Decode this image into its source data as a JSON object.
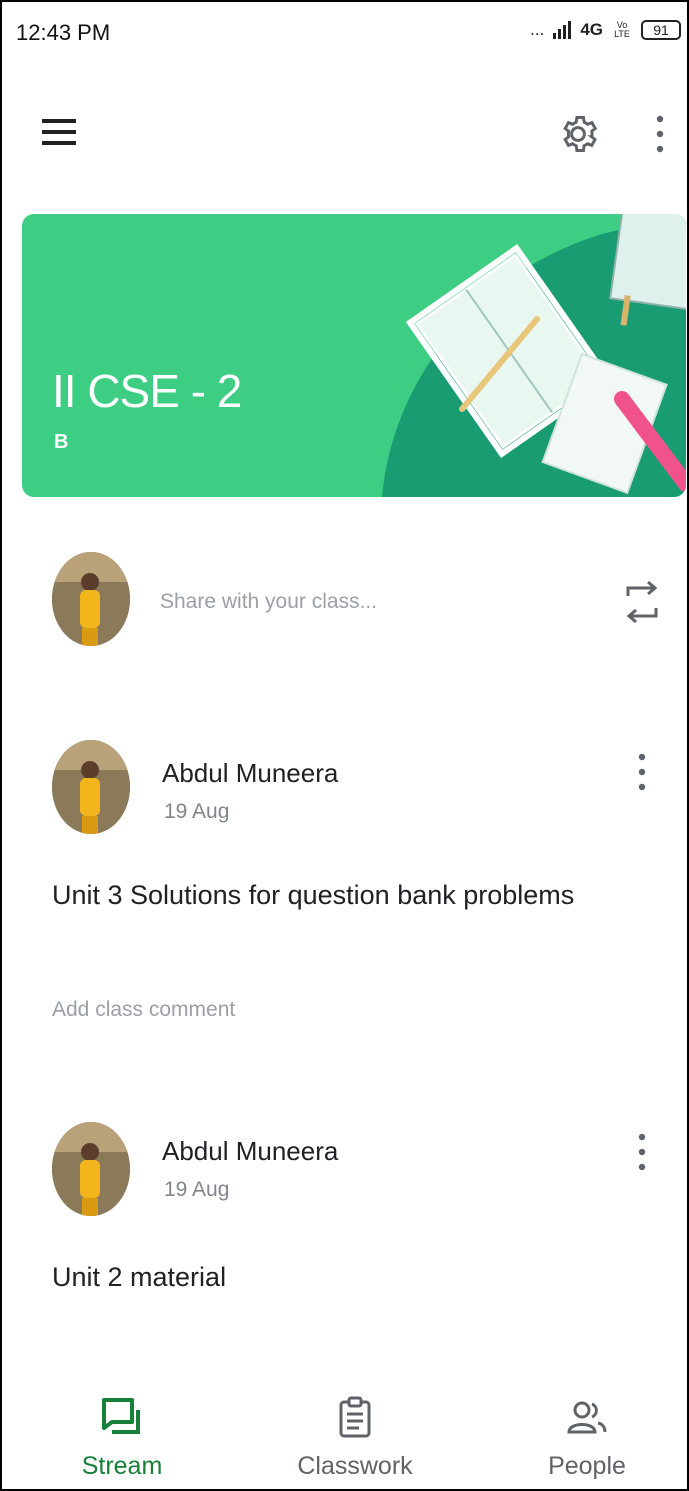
{
  "status_bar": {
    "time": "12:43 PM",
    "signal_text": "...",
    "network": "4G",
    "volte": "Vo LTE",
    "battery": "91"
  },
  "app_bar": {
    "menu_icon": "hamburger-menu-icon",
    "settings_icon": "gear-icon",
    "more_icon": "more-vert-icon"
  },
  "class_banner": {
    "title": "II CSE - 2",
    "section": "B",
    "color": "#3dce83"
  },
  "share": {
    "placeholder": "Share with your class..."
  },
  "posts": [
    {
      "author": "Abdul Muneera",
      "date": "19 Aug",
      "body": "Unit 3 Solutions for question bank problems",
      "comment_prompt": "Add class comment"
    },
    {
      "author": "Abdul Muneera",
      "date": "19 Aug",
      "body": "Unit 2 material"
    }
  ],
  "bottom_nav": {
    "items": [
      {
        "label": "Stream",
        "icon": "stream-icon",
        "active": true
      },
      {
        "label": "Classwork",
        "icon": "clipboard-icon",
        "active": false
      },
      {
        "label": "People",
        "icon": "people-icon",
        "active": false
      }
    ],
    "active_color": "#188038"
  }
}
